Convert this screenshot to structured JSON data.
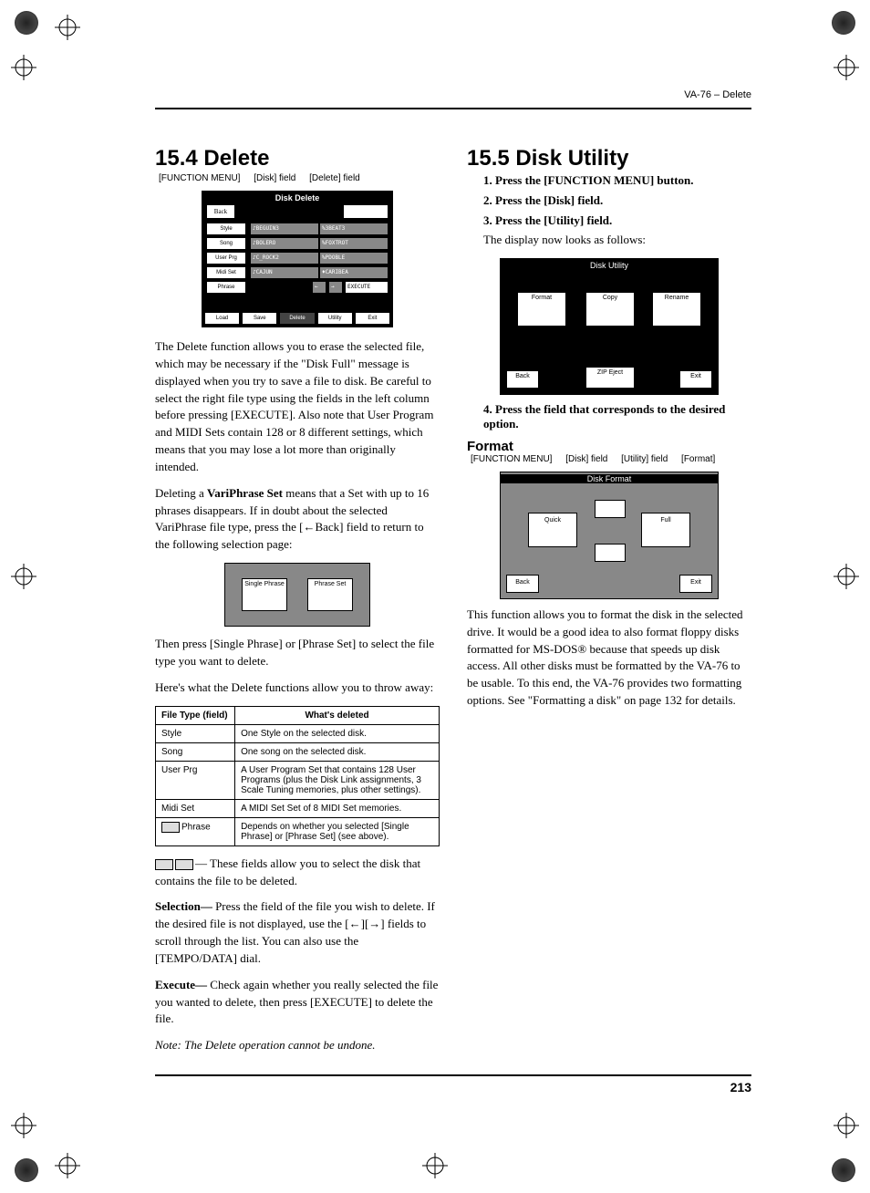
{
  "header": {
    "right": "VA-76 – Delete"
  },
  "left": {
    "heading": "15.4 Delete",
    "crumbs": [
      "[FUNCTION MENU]",
      "[Disk] field",
      "[Delete] field"
    ],
    "screenshot1": {
      "title": "Disk Delete",
      "back": "Back",
      "sidebar": [
        "Style",
        "Song",
        "User Prg",
        "Midi Set",
        "Phrase"
      ],
      "list": [
        [
          "♪BEGUIN3",
          "%3BEAT3"
        ],
        [
          "♪BOLERO",
          "%FOXTROT"
        ],
        [
          "♪C_ROCK2",
          "%PDOBLE"
        ],
        [
          "♪CAJUN",
          "♦CARIBEA"
        ]
      ],
      "bottom": [
        "Load",
        "Save",
        "Delete",
        "Utility",
        "Exit"
      ],
      "execute": "EXECUTE"
    },
    "p1": "The Delete function allows you to erase the selected file, which may be necessary if the \"Disk Full\" message is displayed when you try to save a file to disk. Be careful to select the right file type using the fields in the left column before pressing [EXECUTE]. Also note that User Program and MIDI Sets contain 128 or 8 different settings, which means that you may lose a lot more than originally intended.",
    "p2a": "Deleting a ",
    "p2b": "VariPhrase Set",
    "p2c": " means that a Set with up to 16 phrases disappears. If in doubt about the selected VariPhrase file type, press the [←Back] field to return to the following selection page:",
    "ss_small": {
      "btn1": "Single Phrase",
      "btn2": "Phrase Set"
    },
    "p3": "Then press [Single Phrase] or [Phrase Set] to select the file type you want to delete.",
    "p4": "Here's what the Delete functions allow you to throw away:",
    "table": {
      "h1": "File Type (field)",
      "h2": "What's deleted",
      "rows": [
        {
          "a": "Style",
          "b": "One Style on the selected disk."
        },
        {
          "a": "Song",
          "b": "One song on the selected disk."
        },
        {
          "a": "User Prg",
          "b": "A User Program Set that contains 128 User Programs (plus the Disk Link assignments, 3 Scale Tuning memories, plus other settings)."
        },
        {
          "a": "Midi Set",
          "b": "A MIDI Set Set of 8 MIDI Set memories."
        },
        {
          "a": "Phrase",
          "b": "Depends on whether you selected [Single Phrase] or [Phrase Set] (see above)."
        }
      ]
    },
    "p5": "— These fields allow you to select the disk that contains the file to be deleted.",
    "p6a": "Selection—",
    "p6b": " Press the field of the file you wish to delete. If the desired file is not displayed, use the [←][→] fields to scroll through the list. You can also use the [TEMPO/DATA] dial.",
    "p7a": "Execute—",
    "p7b": " Check again whether you really selected the file you wanted to delete, then press [EXECUTE] to delete the file.",
    "p8": "Note: The Delete operation cannot be undone."
  },
  "right": {
    "heading": "15.5 Disk Utility",
    "steps": [
      "Press the [FUNCTION MENU] button.",
      "Press the [Disk] field.",
      "Press the [Utility] field."
    ],
    "p_after3": "The display now looks as follows:",
    "ss_util": {
      "title": "Disk Utility",
      "btns": [
        "Format",
        "Copy",
        "Rename"
      ],
      "zip": "ZIP Eject",
      "back": "Back",
      "exit": "Exit"
    },
    "step4": "Press the field that corresponds to the desired option.",
    "sub": "Format",
    "crumbs2": [
      "[FUNCTION MENU]",
      "[Disk] field",
      "[Utility] field",
      "[Format]"
    ],
    "ss_fmt": {
      "title": "Disk Format",
      "btns": [
        "Quick",
        "Full"
      ],
      "back": "Back",
      "exit": "Exit"
    },
    "p_fmt": "This function allows you to format the disk in the selected drive. It would be a good idea to also format floppy disks formatted for MS-DOS® because that speeds up disk access. All other disks must be formatted by the VA-76 to be usable. To this end, the VA-76 provides two formatting options. See \"Formatting a disk\" on page 132 for details."
  },
  "pagenum": "213"
}
